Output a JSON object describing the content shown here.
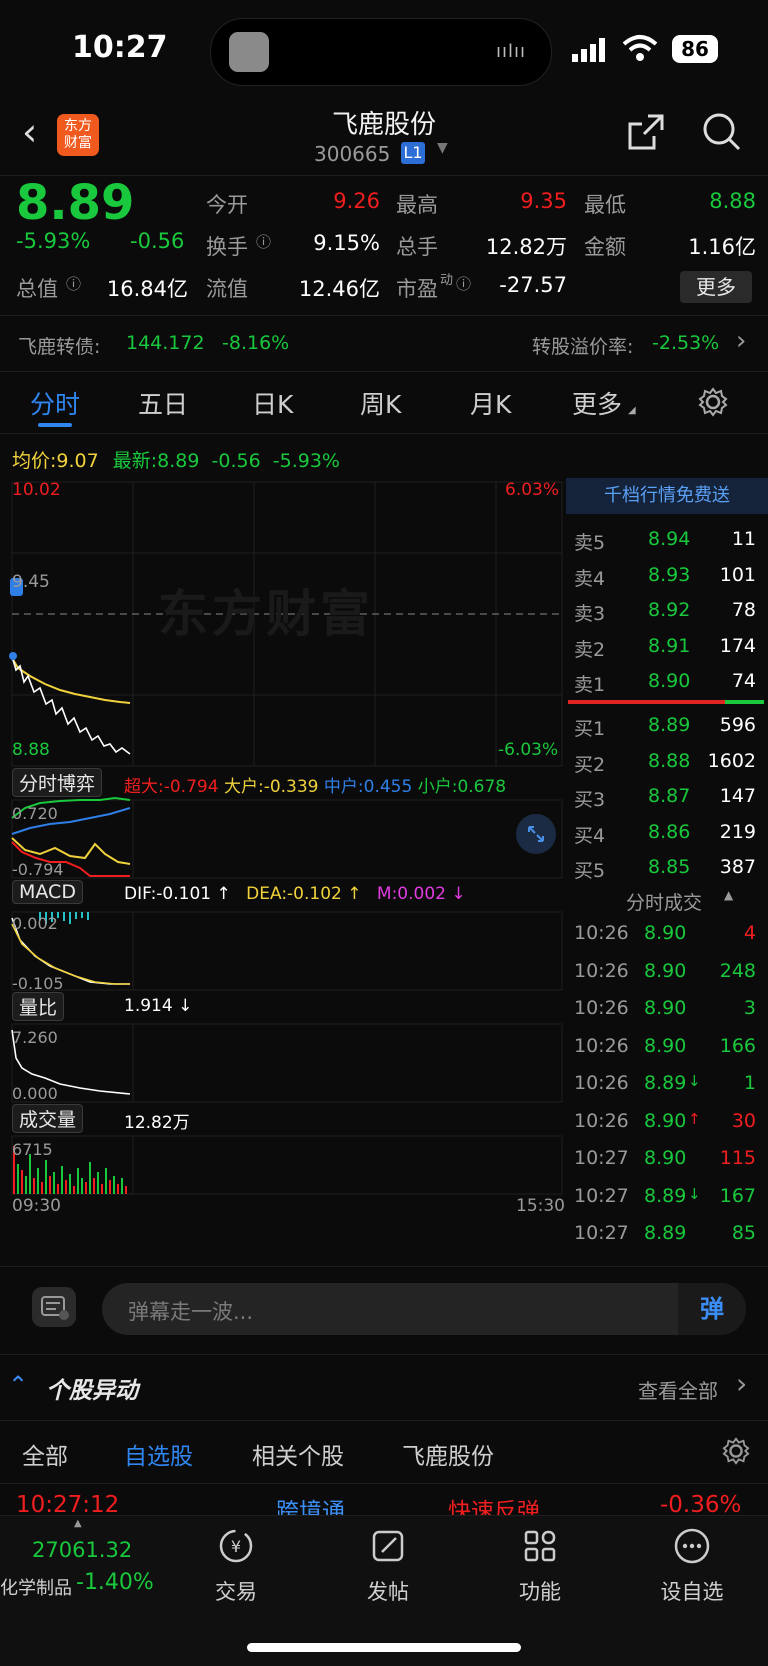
{
  "status": {
    "time": "10:27",
    "battery": "86"
  },
  "header": {
    "logo_line1": "东方",
    "logo_line2": "财富",
    "title": "飞鹿股份",
    "code": "300665",
    "level": "L1"
  },
  "quote": {
    "price": "8.89",
    "change_pct": "-5.93%",
    "change": "-0.56",
    "open_label": "今开",
    "open": "9.26",
    "high_label": "最高",
    "high": "9.35",
    "low_label": "最低",
    "low": "8.88",
    "turnover_label": "换手",
    "turnover": "9.15%",
    "volume_label": "总手",
    "volume": "12.82万",
    "amount_label": "金额",
    "amount": "1.16亿",
    "mcap_label": "总值",
    "mcap": "16.84亿",
    "float_label": "流值",
    "float": "12.46亿",
    "pe_label": "市盈",
    "pe_sup": "动",
    "pe": "-27.57",
    "more": "更多"
  },
  "convert": {
    "label": "飞鹿转债:",
    "price": "144.172",
    "pct": "-8.16%",
    "premium_label": "转股溢价率:",
    "premium": "-2.53%"
  },
  "tabs": [
    "分时",
    "五日",
    "日K",
    "周K",
    "月K",
    "更多"
  ],
  "chart": {
    "avg_label": "均价:",
    "avg": "9.07",
    "latest_label": "最新:",
    "latest": "8.89",
    "chg": "-0.56",
    "pct": "-5.93%",
    "top_price": "10.02",
    "top_pct": "6.03%",
    "ref_price": "9.45",
    "bottom_price": "8.88",
    "bottom_pct": "-6.03%",
    "watermark": "东方财富",
    "game_label": "分时博弈",
    "cd_label": "超大:",
    "cd": "-0.794",
    "dh_label": "大户:",
    "dh": "-0.339",
    "zh_label": "中户:",
    "zh": "0.455",
    "xh_label": "小户:",
    "xh": "0.678",
    "game_top": "0.720",
    "game_bottom": "-0.794",
    "macd_label": "MACD",
    "dif": "DIF:-0.101 ↑",
    "dea": "DEA:-0.102 ↑",
    "m": "M:0.002 ↓",
    "macd_top": "0.002",
    "macd_bottom": "-0.105",
    "lb_label": "量比",
    "lb": "1.914 ↓",
    "lb_top": "7.260",
    "lb_bottom": "0.000",
    "vol_label": "成交量",
    "vol": "12.82万",
    "vol_top": "6715",
    "time_start": "09:30",
    "time_end": "15:30"
  },
  "orderbook": {
    "banner": "千档行情免费送",
    "sell": [
      {
        "label": "卖5",
        "price": "8.94",
        "qty": "11"
      },
      {
        "label": "卖4",
        "price": "8.93",
        "qty": "101"
      },
      {
        "label": "卖3",
        "price": "8.92",
        "qty": "78"
      },
      {
        "label": "卖2",
        "price": "8.91",
        "qty": "174"
      },
      {
        "label": "卖1",
        "price": "8.90",
        "qty": "74"
      }
    ],
    "buy": [
      {
        "label": "买1",
        "price": "8.89",
        "qty": "596"
      },
      {
        "label": "买2",
        "price": "8.88",
        "qty": "1602"
      },
      {
        "label": "买3",
        "price": "8.87",
        "qty": "147"
      },
      {
        "label": "买4",
        "price": "8.86",
        "qty": "219"
      },
      {
        "label": "买5",
        "price": "8.85",
        "qty": "387"
      }
    ],
    "ticks_label": "分时成交",
    "ticks": [
      {
        "time": "10:26",
        "price": "8.90",
        "arrow": "",
        "qty": "4",
        "dir": "red"
      },
      {
        "time": "10:26",
        "price": "8.90",
        "arrow": "",
        "qty": "248",
        "dir": "green"
      },
      {
        "time": "10:26",
        "price": "8.90",
        "arrow": "",
        "qty": "3",
        "dir": "green"
      },
      {
        "time": "10:26",
        "price": "8.90",
        "arrow": "",
        "qty": "166",
        "dir": "green"
      },
      {
        "time": "10:26",
        "price": "8.89",
        "arrow": "↓",
        "qty": "1",
        "dir": "green"
      },
      {
        "time": "10:26",
        "price": "8.90",
        "arrow": "↑",
        "qty": "30",
        "dir": "red"
      },
      {
        "time": "10:27",
        "price": "8.90",
        "arrow": "",
        "qty": "115",
        "dir": "red"
      },
      {
        "time": "10:27",
        "price": "8.89",
        "arrow": "↓",
        "qty": "167",
        "dir": "green"
      },
      {
        "time": "10:27",
        "price": "8.89",
        "arrow": "",
        "qty": "85",
        "dir": "green"
      }
    ]
  },
  "danmu": {
    "placeholder": "弹幕走一波...",
    "send": "弹"
  },
  "anomaly": {
    "title": "个股异动",
    "view_all": "查看全部",
    "tabs": [
      "全部",
      "自选股",
      "相关个股",
      "飞鹿股份"
    ],
    "row": {
      "time": "10:27:12",
      "tag": "跨境通",
      "event": "快速反弹",
      "pct": "-0.36%"
    }
  },
  "bottom": {
    "index_value": "27061.32",
    "index_name": "化学制品",
    "index_pct": "-1.40%",
    "nav": [
      "交易",
      "发帖",
      "功能",
      "设自选"
    ]
  }
}
